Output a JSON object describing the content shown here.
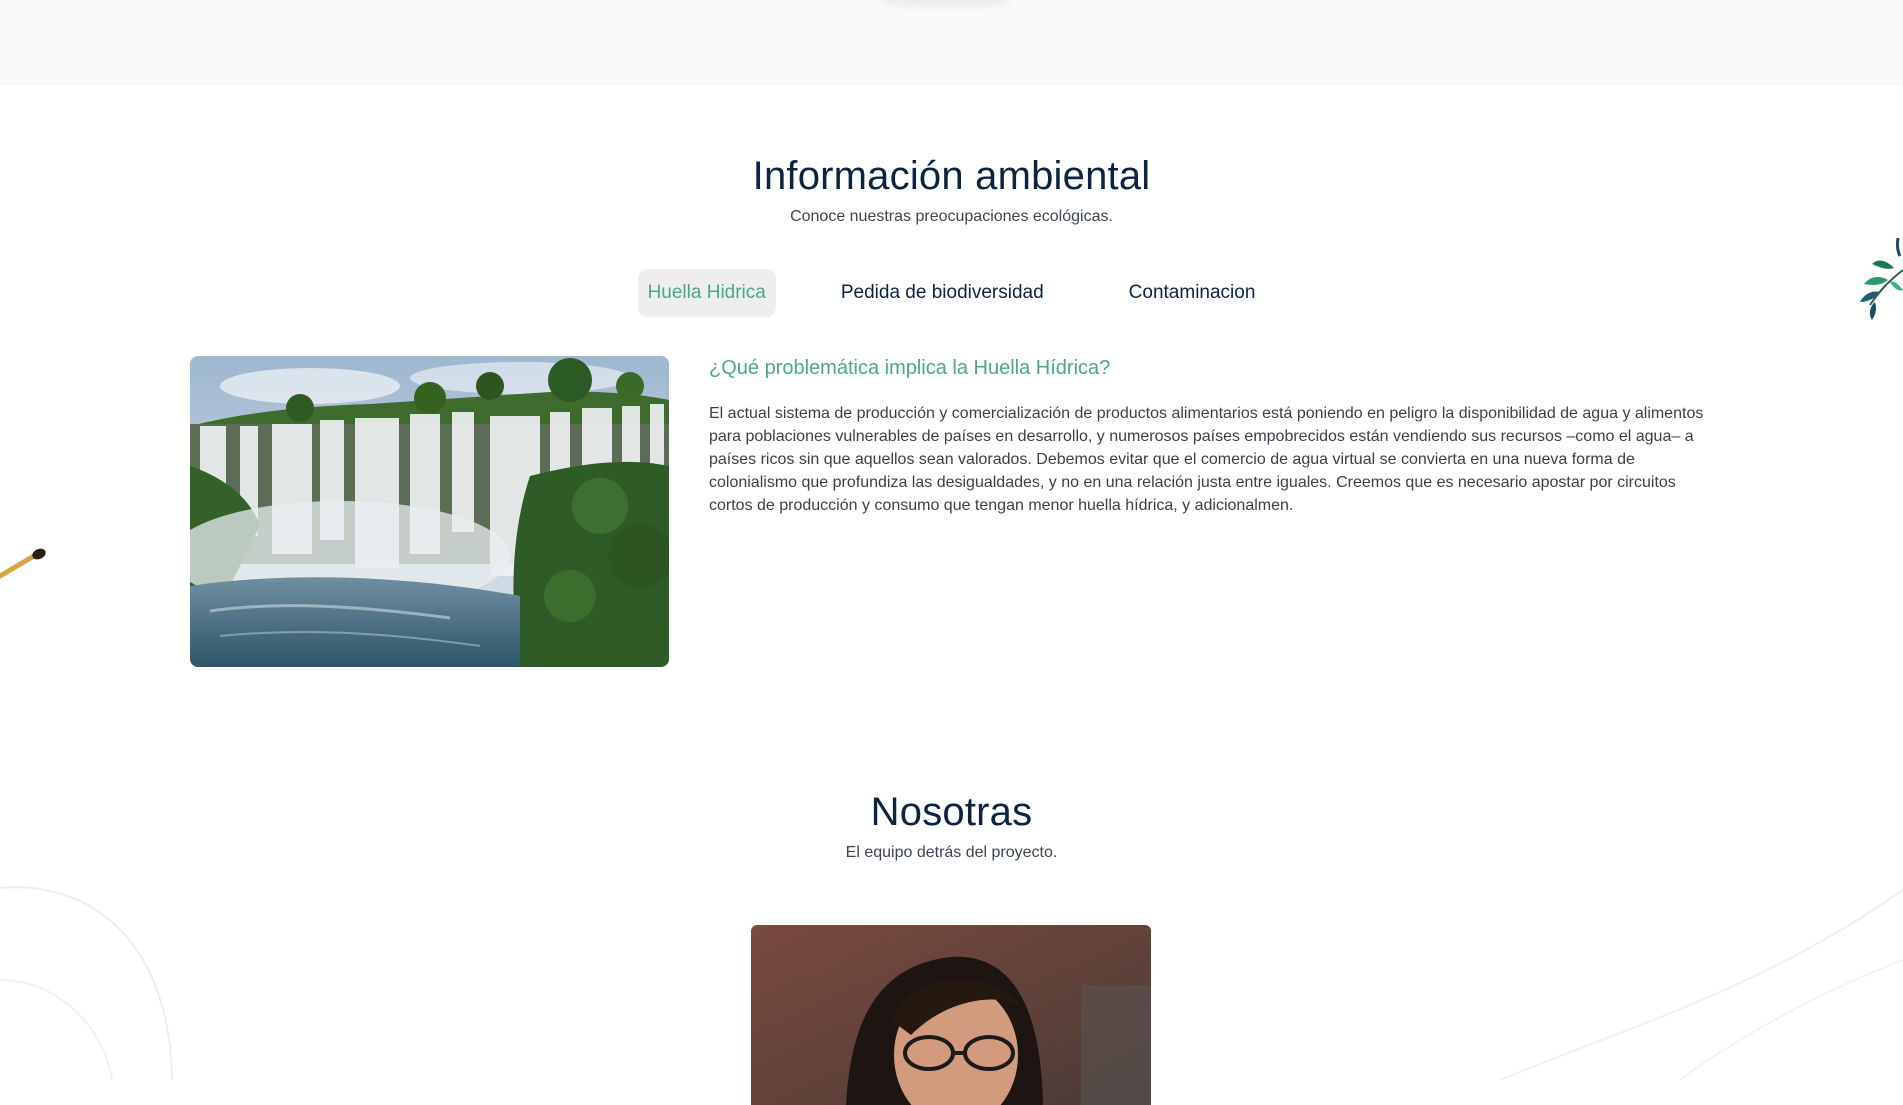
{
  "info_section": {
    "title": "Información ambiental",
    "subtitle": "Conoce nuestras preocupaciones ecológicas.",
    "tabs": [
      {
        "label": "Huella Hidrica",
        "active": true
      },
      {
        "label": "Pedida de biodiversidad",
        "active": false
      },
      {
        "label": "Contaminacion",
        "active": false
      }
    ],
    "panel": {
      "image_alt": "waterfall-photo",
      "heading": "¿Qué problemática implica la Huella Hídrica?",
      "body": "El actual sistema de producción y comercialización de productos alimentarios está poniendo en peligro la disponibilidad de agua y alimentos para poblaciones vulnerables de países en desarrollo, y numerosos países empobrecidos están vendiendo sus recursos –como el agua– a países ricos sin que aquellos sean valorados. Debemos evitar que el comercio de agua virtual se convierta en una nueva forma de colonialismo que profundiza las desigualdades, y no en una relación justa entre iguales. Creemos que es necesario apostar por circuitos cortos de producción y consumo que tengan menor huella hídrica, y adicionalmen."
    }
  },
  "team_section": {
    "title": "Nosotras",
    "subtitle": "El equipo detrás del proyecto.",
    "member_photo_alt": "team-member-photo"
  },
  "colors": {
    "heading": "#0b2440",
    "accent": "#4aa887",
    "tab_active_bg": "#eeeeee",
    "top_band": "#fafafb"
  },
  "icons": {
    "right_decoration": "leaf-branch-icon",
    "left_decoration": "wooden-spoon-icon"
  }
}
